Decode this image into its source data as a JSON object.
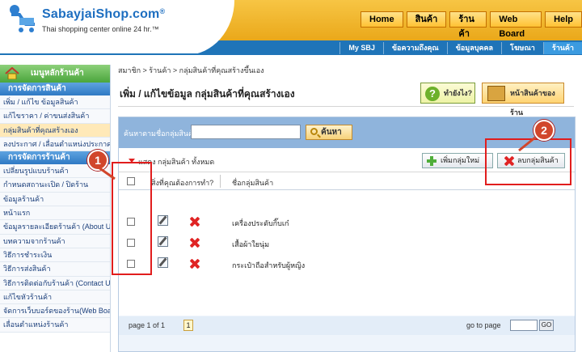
{
  "header": {
    "logo_title": "SabayjaiShop.com",
    "logo_reg": "®",
    "logo_sub": "Thai shopping center online 24 hr.™",
    "top_nav": [
      "Home",
      "สินค้า",
      "ร้านค้า",
      "Web Board",
      "Help"
    ],
    "sub_nav": [
      "My SBJ",
      "ข้อความถึงคุณ",
      "ข้อมูลบุคคล",
      "โฆษณา",
      "ร้านค้า"
    ]
  },
  "sidebar": {
    "home": "เมนูหลักร้านค้า",
    "sections": [
      {
        "title": "การจัดการสินค้า",
        "items": [
          "เพิ่ม / แก้ไข ข้อมูลสินค้า",
          "แก้ไขราคา / ค่าขนส่งสินค้า",
          "กลุ่มสินค้าที่คุณสร้างเอง",
          "ลงประกาศ / เลื่อนตำแหน่งประกาศ"
        ]
      },
      {
        "title": "การจัดการร้านค้า",
        "items": [
          "เปลี่ยนรูปแบบร้านค้า",
          "กำหนดสถานะเปิด / ปิดร้าน",
          "ข้อมูลร้านค้า",
          "หน้าแรก",
          "ข้อมูลรายละเอียดร้านค้า (About Us)",
          "บทความจากร้านค้า",
          "วิธีการชำระเงิน",
          "วิธีการส่งสินค้า",
          "วิธีการติดต่อกับร้านค้า (Contact Us)",
          "แก้ไขหัวร้านค้า",
          "จัดการเว็บบอร์ดของร้าน(Web Board)",
          "เลื่อนตำแหน่งร้านค้า"
        ]
      }
    ]
  },
  "content": {
    "breadcrumb": "สมาชิก > ร้านค้า > กลุ่มสินค้าที่คุณสร้างขึ้นเอง",
    "page_title": "เพิ่ม / แก้ไขข้อมูล กลุ่มสินค้าที่คุณสร้างเอง",
    "help_button": "ทำยังไง?",
    "store_button": "หน้าสินค้าของร้าน",
    "search": {
      "label": "ค้นหาตามชื่อกลุ่มสินค้า",
      "value": "",
      "button": "ค้นหา"
    },
    "toolbar": {
      "show_all": "แสดง กลุ่มสินค้า ทั้งหมด",
      "add": "เพิ่มกลุ่มใหม่",
      "delete": "ลบกลุ่มสินค้า"
    },
    "table": {
      "headers": [
        "สิ่งที่คุณต้องการทำ?",
        "ชื่อกลุ่มสินค้า"
      ],
      "rows": [
        {
          "name": "เครื่องประดับกิ๊บเก๋"
        },
        {
          "name": "เสื้อผ้าใยนุ่ม"
        },
        {
          "name": "กระเป๋าถือสำหรับผู้หญิง"
        }
      ]
    },
    "pager": {
      "text": "page 1 of 1",
      "current": "1",
      "goto_label": "go to page",
      "go_button": "GO"
    }
  },
  "annotations": [
    "1",
    "2"
  ],
  "colors": {
    "accent_orange": "#f7c544",
    "brand_blue": "#1f74b8",
    "callout_red": "#e11d1d"
  }
}
